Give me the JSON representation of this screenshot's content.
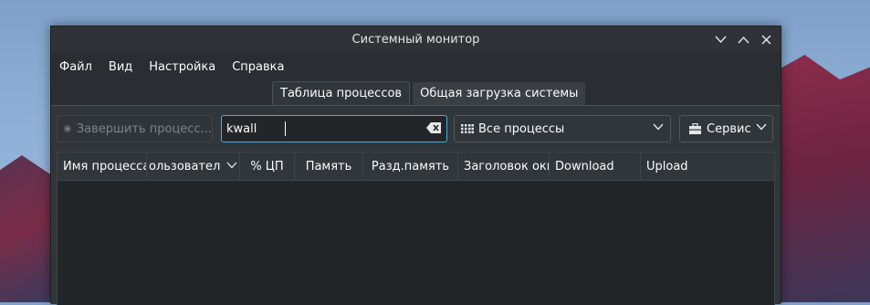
{
  "window": {
    "title": "Системный монитор"
  },
  "menu": [
    {
      "label": "Файл"
    },
    {
      "label": "Вид"
    },
    {
      "label": "Настройка"
    },
    {
      "label": "Справка"
    }
  ],
  "tabs": [
    {
      "label": "Таблица процессов",
      "active": true
    },
    {
      "label": "Общая загрузка системы",
      "active": false
    }
  ],
  "toolbar": {
    "end_process_label": "Завершить процесс...",
    "search_value": "kwall",
    "filter_label": "Все процессы",
    "tools_label": "Сервис"
  },
  "table": {
    "columns": [
      {
        "label": "Имя процесса"
      },
      {
        "label": "ользовател"
      },
      {
        "label": "% ЦП"
      },
      {
        "label": "Память"
      },
      {
        "label": "Разд.память"
      },
      {
        "label": "Заголовок окн"
      },
      {
        "label": "Download"
      },
      {
        "label": "Upload"
      }
    ],
    "rows": []
  },
  "colors": {
    "accent": "#3daee9",
    "window_bg": "#31363b",
    "table_bg": "#232629"
  }
}
